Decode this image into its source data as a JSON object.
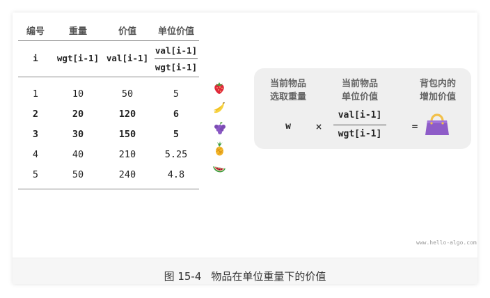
{
  "table": {
    "headers": [
      "编号",
      "重量",
      "价值",
      "单位价值"
    ],
    "symbols": {
      "index": "i",
      "weight": "wgt[i-1]",
      "value": "val[i-1]",
      "unit_value_num": "val[i-1]",
      "unit_value_den": "wgt[i-1]"
    },
    "rows": [
      {
        "i": "1",
        "wgt": "10",
        "val": "50",
        "unit": "5",
        "icon": "strawberry-icon"
      },
      {
        "i": "2",
        "wgt": "20",
        "val": "120",
        "unit": "6",
        "icon": "banana-icon"
      },
      {
        "i": "3",
        "wgt": "30",
        "val": "150",
        "unit": "5",
        "icon": "grapes-icon"
      },
      {
        "i": "4",
        "wgt": "40",
        "val": "210",
        "unit": "5.25",
        "icon": "pineapple-icon"
      },
      {
        "i": "5",
        "wgt": "50",
        "val": "240",
        "unit": "4.8",
        "icon": "watermelon-icon"
      }
    ]
  },
  "panel": {
    "col1_line1": "当前物品",
    "col1_line2": "选取重量",
    "col2_line1": "当前物品",
    "col2_line2": "单位价值",
    "col3_line1": "背包内的",
    "col3_line2": "增加价值",
    "w": "w",
    "times": "×",
    "num": "val[i-1]",
    "den": "wgt[i-1]",
    "equals": "=",
    "result_icon": "handbag-icon"
  },
  "watermark": "www.hello-algo.com",
  "caption": {
    "number": "图 15-4",
    "text": "物品在单位重量下的价值"
  },
  "colors": {
    "panel_bg": "#efefef",
    "bag_purple": "#8e5cc8",
    "bag_handle": "#f2c04a"
  }
}
